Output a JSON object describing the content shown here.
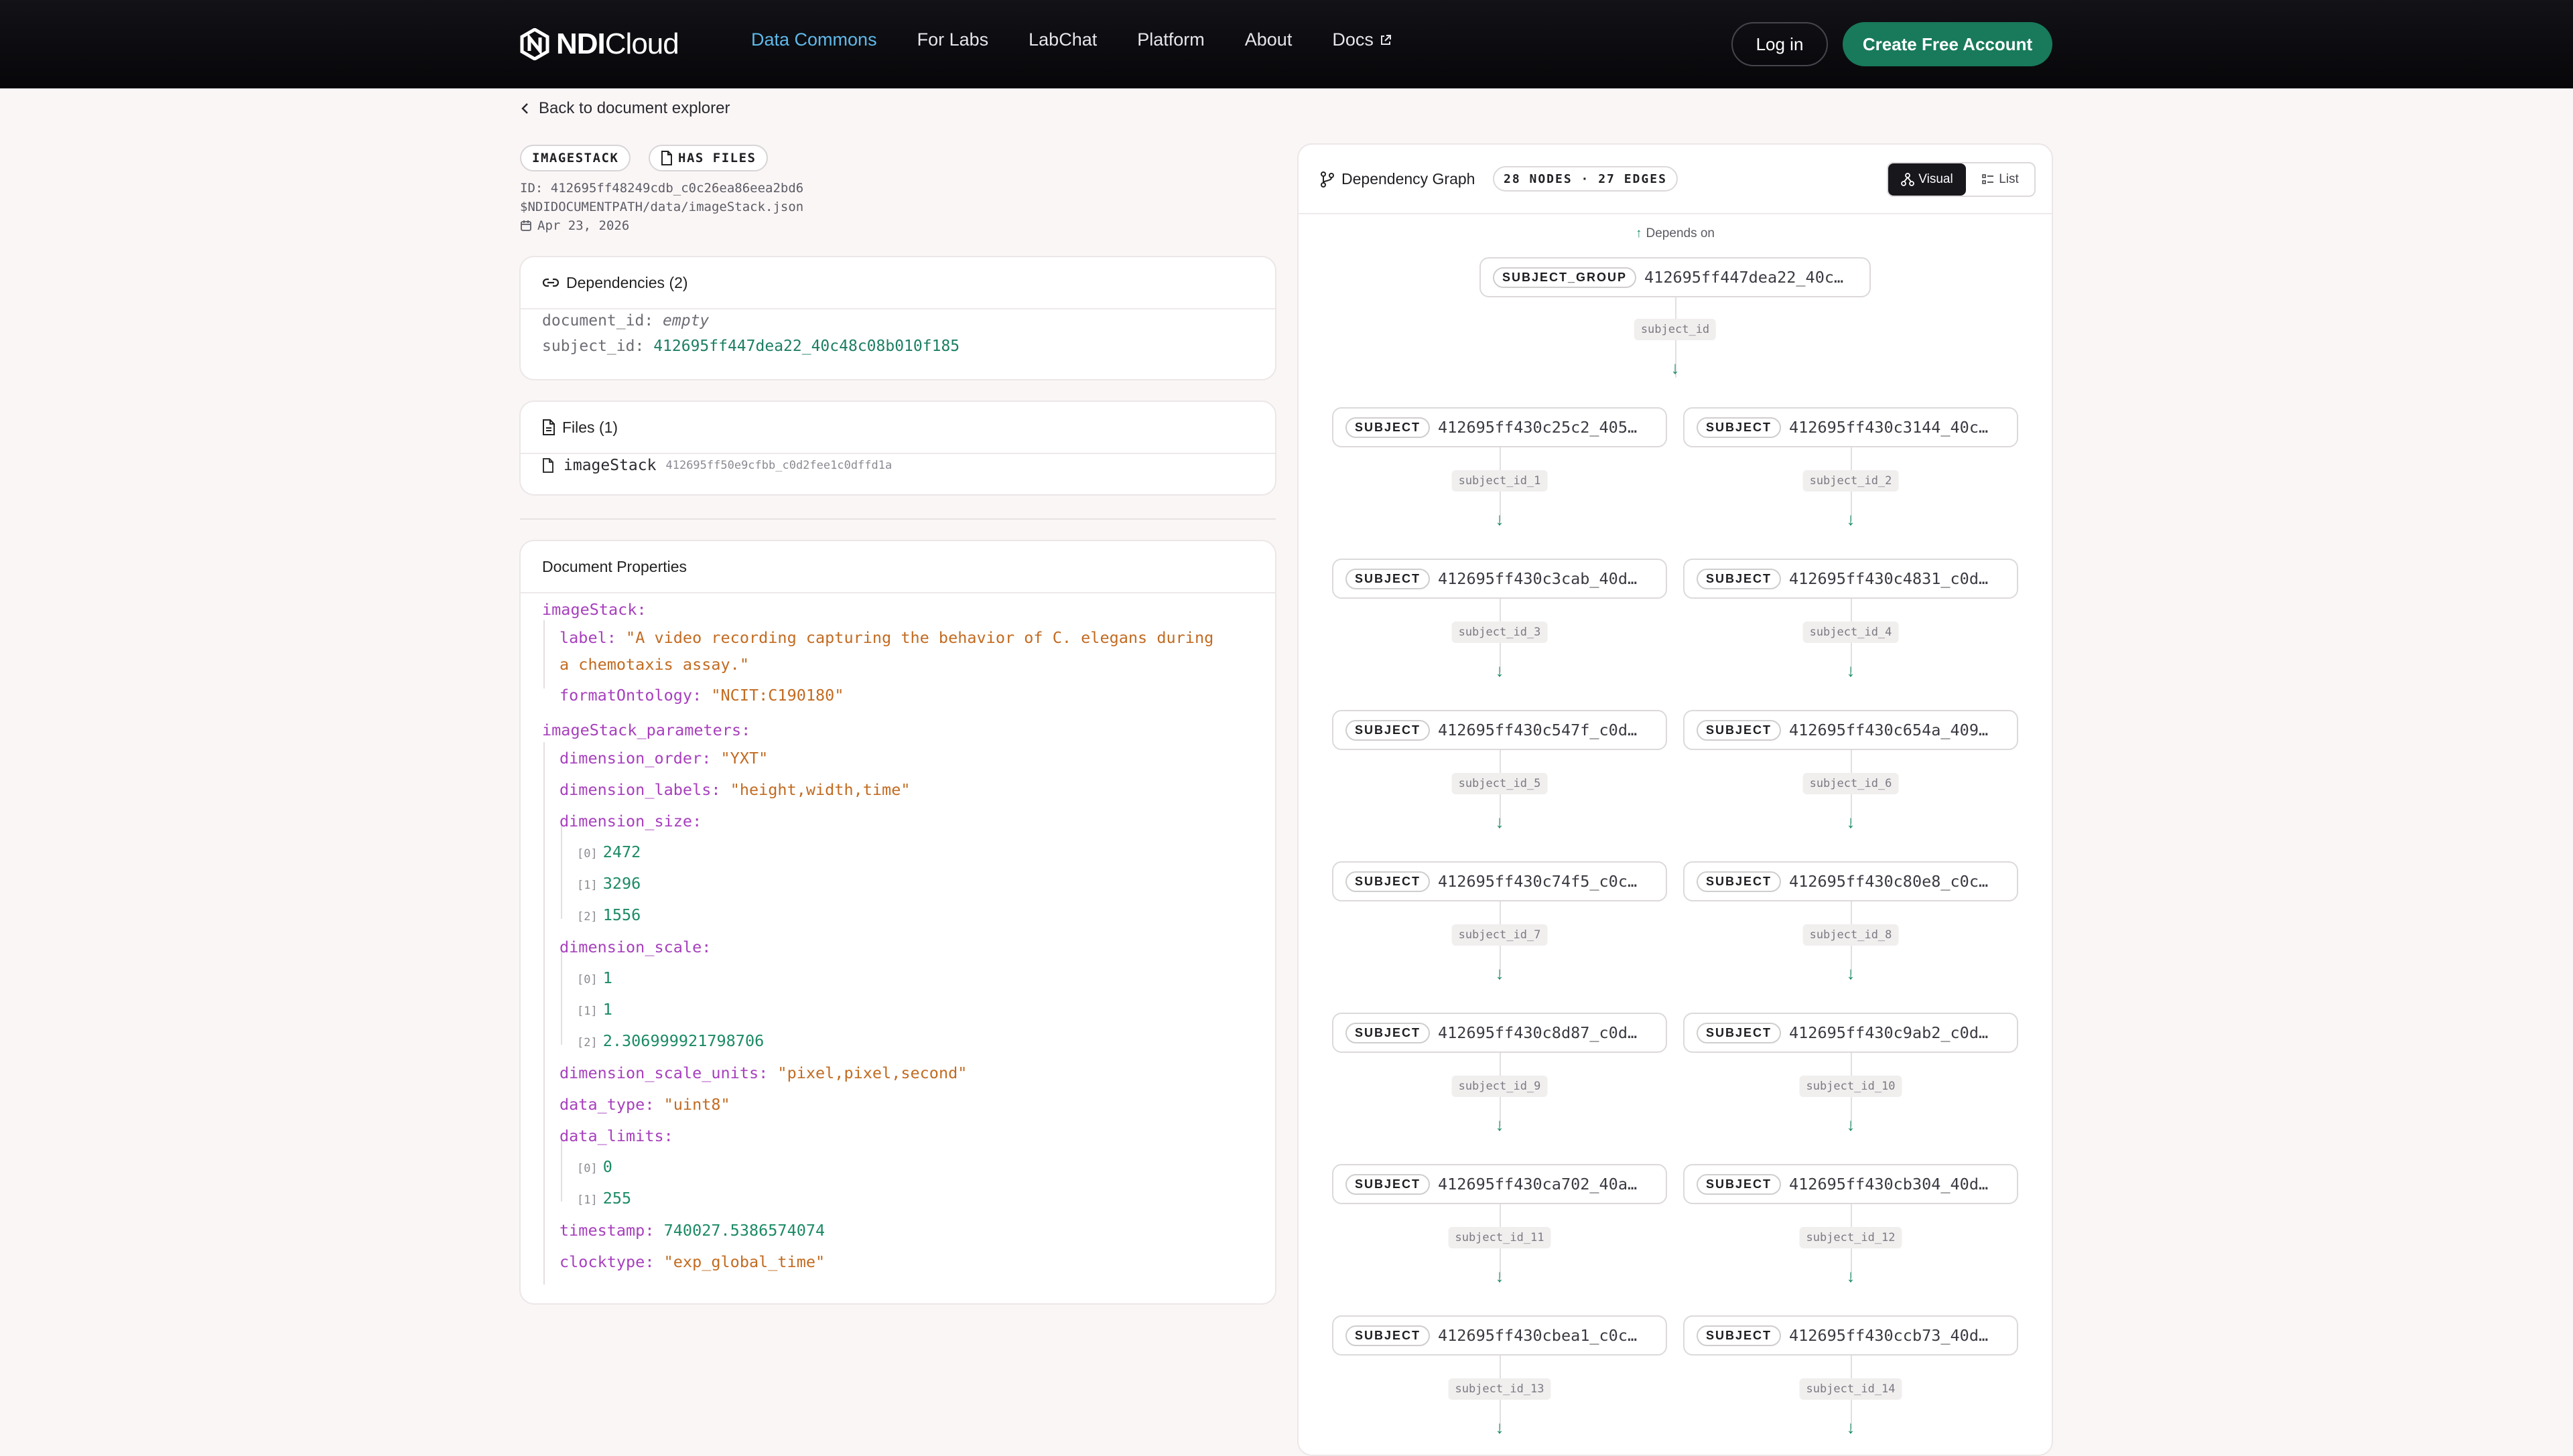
{
  "header": {
    "logo_bold": "NDI",
    "logo_light": "Cloud",
    "nav": [
      "Data Commons",
      "For Labs",
      "LabChat",
      "Platform",
      "About",
      "Docs"
    ],
    "login": "Log in",
    "signup": "Create Free Account"
  },
  "back_link": "Back to document explorer",
  "badges": {
    "type": "IMAGESTACK",
    "files": "HAS FILES"
  },
  "meta": {
    "id": "ID: 412695ff48249cdb_c0c26ea86eea2bd6",
    "path": "$NDIDOCUMENTPATH/data/imageStack.json",
    "date": "Apr 23, 2026"
  },
  "dependencies": {
    "title": "Dependencies (2)",
    "rows": [
      {
        "key": "document_id:",
        "value": "empty"
      },
      {
        "key": "subject_id:",
        "value": "412695ff447dea22_40c48c08b010f185"
      }
    ]
  },
  "files": {
    "title": "Files (1)",
    "name": "imageStack",
    "hash": "412695ff50e9cfbb_c0d2fee1c0dffd1a"
  },
  "properties": {
    "title": "Document Properties",
    "imageStack_key": "imageStack:",
    "label_key": "label:",
    "label_line1": "\"A video recording capturing the behavior of C. elegans during",
    "label_line2": "a chemotaxis assay.\"",
    "formatOntology_key": "formatOntology:",
    "formatOntology_val": "\"NCIT:C190180\"",
    "params_key": "imageStack_parameters:",
    "dimension_order_key": "dimension_order:",
    "dimension_order_val": "\"YXT\"",
    "dimension_labels_key": "dimension_labels:",
    "dimension_labels_val": "\"height,width,time\"",
    "dimension_size_key": "dimension_size:",
    "dimension_size": [
      "2472",
      "3296",
      "1556"
    ],
    "dimension_scale_key": "dimension_scale:",
    "dimension_scale": [
      "1",
      "1",
      "2.306999921798706"
    ],
    "dimension_scale_units_key": "dimension_scale_units:",
    "dimension_scale_units_val": "\"pixel,pixel,second\"",
    "data_type_key": "data_type:",
    "data_type_val": "\"uint8\"",
    "data_limits_key": "data_limits:",
    "data_limits": [
      "0",
      "255"
    ],
    "timestamp_key": "timestamp:",
    "timestamp_val": "740027.5386574074",
    "clocktype_key": "clocktype:",
    "clocktype_val": "\"exp_global_time\""
  },
  "graph": {
    "title": "Dependency Graph",
    "count": "28 NODES · 27 EDGES",
    "toggle_visual": "Visual",
    "toggle_list": "List",
    "depends_on": "Depends on",
    "root": {
      "tag": "SUBJECT_GROUP",
      "id": "412695ff447dea22_40c…"
    },
    "root_edge": "subject_id",
    "nodes": [
      {
        "tag": "SUBJECT",
        "id": "412695ff430c25c2_405…",
        "edge": "subject_id_1"
      },
      {
        "tag": "SUBJECT",
        "id": "412695ff430c3144_40c…",
        "edge": "subject_id_2"
      },
      {
        "tag": "SUBJECT",
        "id": "412695ff430c3cab_40d…",
        "edge": "subject_id_3"
      },
      {
        "tag": "SUBJECT",
        "id": "412695ff430c4831_c0d…",
        "edge": "subject_id_4"
      },
      {
        "tag": "SUBJECT",
        "id": "412695ff430c547f_c0d…",
        "edge": "subject_id_5"
      },
      {
        "tag": "SUBJECT",
        "id": "412695ff430c654a_409…",
        "edge": "subject_id_6"
      },
      {
        "tag": "SUBJECT",
        "id": "412695ff430c74f5_c0c…",
        "edge": "subject_id_7"
      },
      {
        "tag": "SUBJECT",
        "id": "412695ff430c80e8_c0c…",
        "edge": "subject_id_8"
      },
      {
        "tag": "SUBJECT",
        "id": "412695ff430c8d87_c0d…",
        "edge": "subject_id_9"
      },
      {
        "tag": "SUBJECT",
        "id": "412695ff430c9ab2_c0d…",
        "edge": "subject_id_10"
      },
      {
        "tag": "SUBJECT",
        "id": "412695ff430ca702_40a…",
        "edge": "subject_id_11"
      },
      {
        "tag": "SUBJECT",
        "id": "412695ff430cb304_40d…",
        "edge": "subject_id_12"
      },
      {
        "tag": "SUBJECT",
        "id": "412695ff430cbea1_c0c…",
        "edge": "subject_id_13"
      },
      {
        "tag": "SUBJECT",
        "id": "412695ff430ccb73_40d…",
        "edge": "subject_id_14"
      }
    ]
  }
}
